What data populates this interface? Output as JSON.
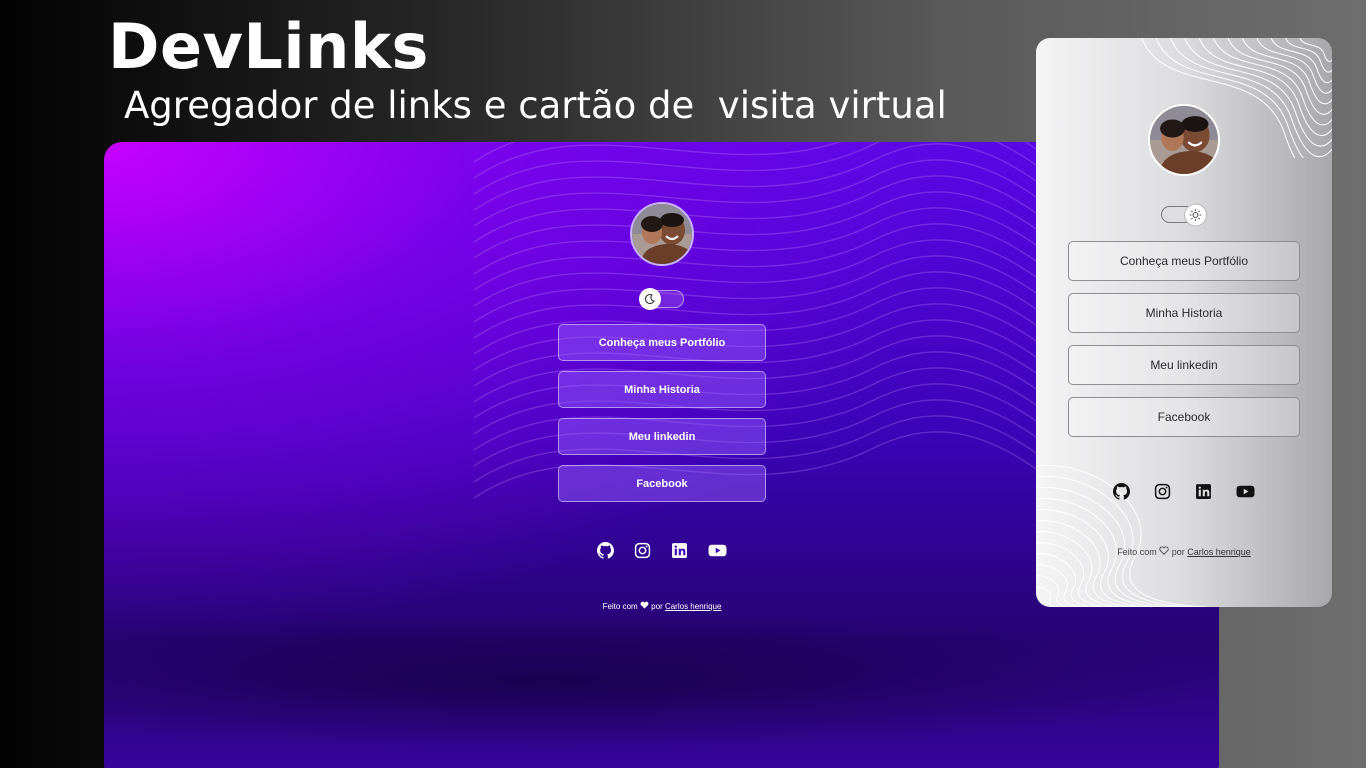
{
  "hero": {
    "title": "DevLinks",
    "subtitle": "Agregador de links e cartão de  visita virtual"
  },
  "theme": {
    "dark": {
      "accent": "#5a07e6",
      "highlight": "#cd00ff",
      "text": "#ffffff"
    },
    "light": {
      "background": "#dcdcde",
      "text": "#2a2a2e",
      "border": "#8d8d92"
    }
  },
  "dark_mockup": {
    "toggle_icon": "moon-icon",
    "links": [
      {
        "label": "Conheça meus Portfólio"
      },
      {
        "label": "Minha Historia"
      },
      {
        "label": "Meu linkedin"
      },
      {
        "label": "Facebook"
      }
    ],
    "social_icons": [
      "github-icon",
      "instagram-icon",
      "linkedin-icon",
      "youtube-icon"
    ],
    "footer": {
      "made_with": "Feito com",
      "by": "por",
      "author": "Carlos henrique"
    }
  },
  "light_mockup": {
    "toggle_icon": "sun-icon",
    "links": [
      {
        "label": "Conheça meus Portfólio"
      },
      {
        "label": "Minha Historia"
      },
      {
        "label": "Meu linkedin"
      },
      {
        "label": "Facebook"
      }
    ],
    "social_icons": [
      "github-icon",
      "instagram-icon",
      "linkedin-icon",
      "youtube-icon"
    ],
    "footer": {
      "made_with": "Feito com",
      "by": "por",
      "author": "Carlos henrique"
    }
  }
}
